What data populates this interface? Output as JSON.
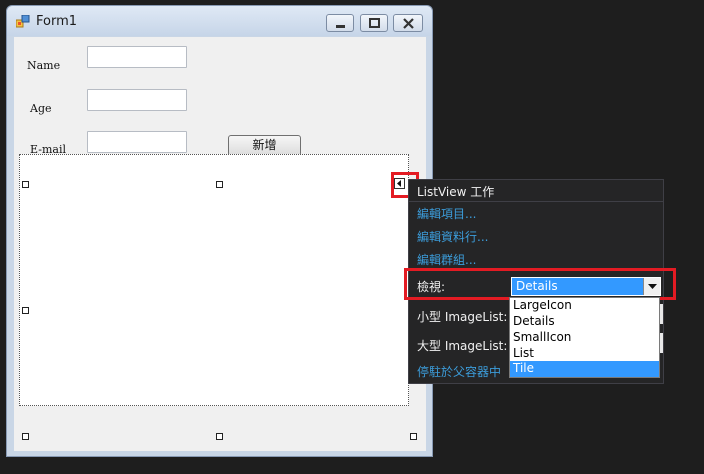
{
  "window": {
    "title": "Form1"
  },
  "form": {
    "name_label": "Name",
    "age_label": "Age",
    "email_label": "E-mail",
    "add_button": "新增"
  },
  "smart_panel": {
    "title": "ListView 工作",
    "edit_items": "編輯項目...",
    "edit_columns": "編輯資料行...",
    "edit_groups": "編輯群組...",
    "view_label": "檢視:",
    "view_value": "Details",
    "small_imagelist_label": "小型 ImageList:",
    "large_imagelist_label": "大型 ImageList:",
    "dock_link": "停駐於父容器中"
  },
  "view_options": [
    "LargeIcon",
    "Details",
    "SmallIcon",
    "List",
    "Tile"
  ],
  "highlighted_option": "Tile",
  "colors": {
    "accent": "#3399ff",
    "link": "#3c9ddb",
    "annotation": "#e31b23"
  }
}
